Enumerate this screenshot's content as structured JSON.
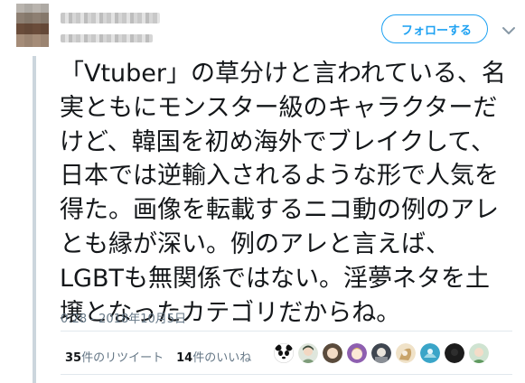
{
  "tweet": {
    "follow_label": "フォローする",
    "text_lines": [
      "「Vtuber」の草分けと言われている、名",
      "実ともにモンスター級のキャラクターだ",
      "けど、韓国を初め海外でブレイクして、",
      "日本では逆輸入されるような形で人気を",
      "得た。画像を転載するニコ動の例のアレ",
      "とも縁が深い。例のアレと言えば、",
      "LGBTも無関係ではない。淫夢ネタを土",
      "壌となったカテゴリだからね。"
    ],
    "timestamp": "0:28 - 2018年10月5日",
    "retweets": {
      "count": "35",
      "label": "件のリツイート"
    },
    "likes": {
      "count": "14",
      "label": "件のいいね"
    }
  },
  "likers": [
    {
      "icon": "panda-avatar-icon",
      "color": "#ffffff"
    },
    {
      "icon": "anime-character-avatar-icon",
      "color": "#7e9c7a"
    },
    {
      "icon": "anime-character-avatar-icon",
      "color": "#d78a3e"
    },
    {
      "icon": "anime-character-avatar-icon",
      "color": "#e8c84a"
    },
    {
      "icon": "anime-character-avatar-icon",
      "color": "#3f4650"
    },
    {
      "icon": "anime-character-avatar-icon",
      "color": "#c9a46a"
    },
    {
      "icon": "anime-character-avatar-icon",
      "color": "#3aa5c8"
    },
    {
      "icon": "dark-avatar-icon",
      "color": "#1c1c1c"
    },
    {
      "icon": "anime-character-avatar-icon",
      "color": "#5f9a5f"
    }
  ],
  "colors": {
    "accent": "#1da1f2",
    "text": "#14171a",
    "muted": "#657786",
    "divider": "#e1e8ed"
  }
}
